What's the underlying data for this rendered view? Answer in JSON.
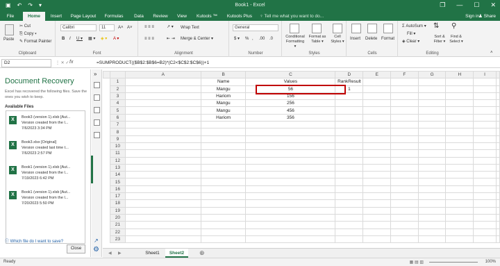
{
  "window": {
    "title": "Book1 - Excel",
    "controls": {
      "restore": "❐",
      "minimize": "—",
      "maximize": "☐",
      "close": "✕"
    }
  },
  "tabs": [
    "File",
    "Home",
    "Insert",
    "Page Layout",
    "Formulas",
    "Data",
    "Review",
    "View",
    "Kutools ™",
    "Kutools Plus"
  ],
  "tell_me": "♀ Tell me what you want to do...",
  "sign_in": "Sign in",
  "share": "♟ Share",
  "ribbon": {
    "clipboard": {
      "label": "Clipboard",
      "paste": "Paste",
      "cut": "✂ Cut",
      "copy": "⎘ Copy ▾",
      "format_painter": "✎ Format Painter"
    },
    "font": {
      "label": "Font",
      "name": "Calibri",
      "size": "11",
      "bold": "B",
      "italic": "I",
      "underline": "U ▾",
      "grow": "A˄",
      "shrink": "A˅"
    },
    "alignment": {
      "label": "Alignment",
      "wrap": "Wrap Text",
      "merge": "Merge & Center ▾"
    },
    "number": {
      "label": "Number",
      "format": "General",
      "currency": "$ ▾",
      "percent": "%",
      "comma": ",",
      "inc": ".00",
      "dec": ".0"
    },
    "styles": {
      "label": "Styles",
      "conditional": "Conditional Formatting ▾",
      "format_table": "Format as Table ▾",
      "cell_styles": "Cell Styles ▾"
    },
    "cells": {
      "label": "Cells",
      "insert": "Insert",
      "delete": "Delete",
      "format": "Format"
    },
    "editing": {
      "label": "Editing",
      "autosum": "Σ AutoSum ▾",
      "fill": "Fill ▾",
      "clear": "◈ Clear ▾",
      "sort": "Sort & Filter ▾",
      "find": "Find & Select ▾"
    }
  },
  "formula_bar": {
    "name_box": "D2",
    "fx": "fx",
    "formula": "=SUMPRODUCT(($B$2:$B$6=B2)*(C2<$C$2:$C$6))+1"
  },
  "recovery": {
    "title": "Document Recovery",
    "description": "Excel has recovered the following files. Save the ones you wish to keep.",
    "available": "Available Files",
    "files": [
      {
        "name": "Book3 (version 1).xlsb [Aut...",
        "detail": "Version created from the l...",
        "date": "7/6/2023 3:34 PM"
      },
      {
        "name": "Book3.xlsx [Original]",
        "detail": "Version created last time t...",
        "date": "7/6/2023 2:57 PM"
      },
      {
        "name": "Book1 (version 1).xlsb [Aut...",
        "detail": "Version created from the l...",
        "date": "7/19/2023 6:42 PM"
      },
      {
        "name": "Book1 (version 1).xlsb [Aut...",
        "detail": "Version created from the l...",
        "date": "7/20/2023 5:50 PM"
      }
    ],
    "help": "Which file do I want to save?",
    "close": "Close"
  },
  "sheet": {
    "columns": [
      "A",
      "B",
      "C",
      "D",
      "E",
      "F",
      "G",
      "H",
      "I"
    ],
    "headers": {
      "name": "Name",
      "values": "Values",
      "rank": "RankResult"
    },
    "rows": [
      {
        "name": "Mangu",
        "value": "56",
        "rank": "1"
      },
      {
        "name": "Hariom",
        "value": "156",
        "rank": ""
      },
      {
        "name": "Mangu",
        "value": "256",
        "rank": ""
      },
      {
        "name": "Mangu",
        "value": "456",
        "rank": ""
      },
      {
        "name": "Hariom",
        "value": "356",
        "rank": ""
      }
    ],
    "row_count": 23
  },
  "sheet_tabs": [
    "Sheet1",
    "Sheet2"
  ],
  "add_sheet": "⊕",
  "status": "Ready",
  "zoom": "100%"
}
